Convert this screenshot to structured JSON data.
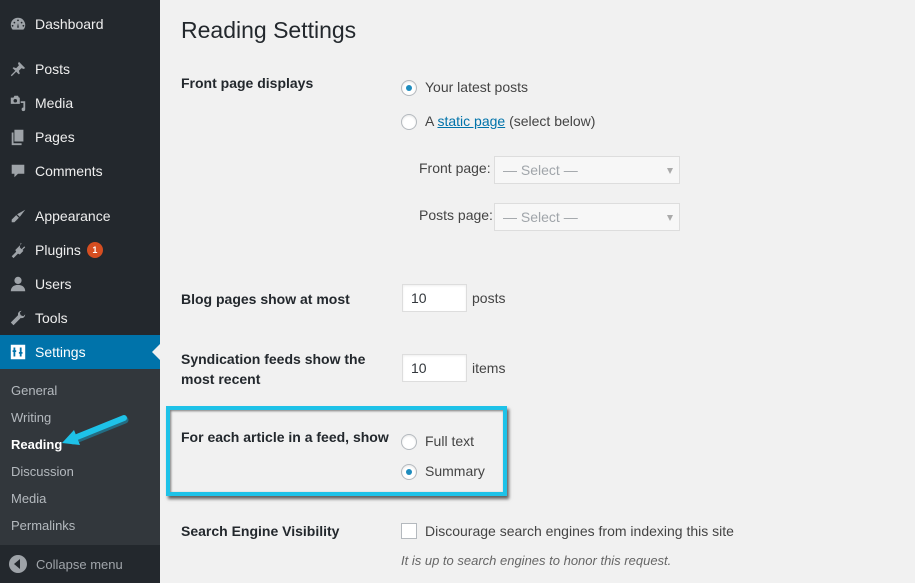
{
  "sidebar": {
    "items": [
      {
        "label": "Dashboard",
        "icon": "dashboard-icon"
      },
      {
        "label": "Posts",
        "icon": "pin-icon"
      },
      {
        "label": "Media",
        "icon": "media-icon"
      },
      {
        "label": "Pages",
        "icon": "pages-icon"
      },
      {
        "label": "Comments",
        "icon": "comment-icon"
      },
      {
        "label": "Appearance",
        "icon": "paintbrush-icon"
      },
      {
        "label": "Plugins",
        "icon": "plug-icon",
        "badge": "1"
      },
      {
        "label": "Users",
        "icon": "user-icon"
      },
      {
        "label": "Tools",
        "icon": "wrench-icon"
      },
      {
        "label": "Settings",
        "icon": "settings-sliders-icon",
        "active": true
      }
    ],
    "submenu": [
      {
        "label": "General"
      },
      {
        "label": "Writing"
      },
      {
        "label": "Reading",
        "current": true
      },
      {
        "label": "Discussion"
      },
      {
        "label": "Media"
      },
      {
        "label": "Permalinks"
      }
    ],
    "collapse_label": "Collapse menu"
  },
  "page": {
    "title": "Reading Settings",
    "front_page_displays": {
      "label": "Front page displays",
      "option_latest": "Your latest posts",
      "option_static_prefix": "A",
      "option_static_link": "static page",
      "option_static_suffix": "(select below)",
      "selected": "latest",
      "front_page_label": "Front page:",
      "front_page_value": "— Select —",
      "posts_page_label": "Posts page:",
      "posts_page_value": "— Select —"
    },
    "blog_pages": {
      "label": "Blog pages show at most",
      "value": "10",
      "unit": "posts"
    },
    "syndication": {
      "label_line1": "Syndication feeds show the",
      "label_line2": "most recent",
      "value": "10",
      "unit": "items"
    },
    "feed_article": {
      "label": "For each article in a feed, show",
      "option_full": "Full text",
      "option_summary": "Summary",
      "selected": "summary"
    },
    "search_visibility": {
      "label": "Search Engine Visibility",
      "checkbox_label": "Discourage search engines from indexing this site",
      "checked": false,
      "description": "It is up to search engines to honor this request."
    }
  },
  "annotation": {
    "highlight_color": "#1ec2e8",
    "arrow_color": "#1ec2e8"
  }
}
